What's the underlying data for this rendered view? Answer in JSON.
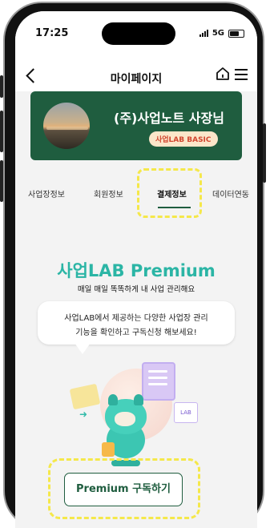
{
  "status_bar": {
    "time": "17:25",
    "network": "5G"
  },
  "header": {
    "title": "마이페이지"
  },
  "profile": {
    "name": "(주)사업노트 사장님",
    "plan_badge": "사업LAB BASIC"
  },
  "tabs": [
    {
      "label": "사업장정보",
      "active": false
    },
    {
      "label": "회원정보",
      "active": false
    },
    {
      "label": "결제정보",
      "active": true
    },
    {
      "label": "데이터연동",
      "active": false
    }
  ],
  "promo": {
    "title": "사업LAB Premium",
    "subtitle": "매일 매일 똑똑하게 내 사업 관리해요",
    "bubble_lines": [
      "사업LAB에서 제공하는 다양한 사업장 관리",
      "기능을 확인하고 구독신청 해보세요!"
    ],
    "lab_card_text": "LAB"
  },
  "cta": {
    "label": "Premium 구독하기"
  },
  "colors": {
    "brand_green": "#1f5d3f",
    "accent_teal": "#2bb5a5",
    "highlight_yellow": "#f5e84a",
    "badge_red": "#d1462f"
  }
}
